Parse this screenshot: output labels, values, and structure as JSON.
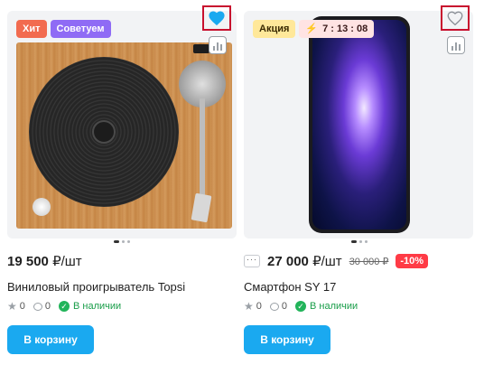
{
  "products": [
    {
      "badges": [
        "Хит",
        "Советуем"
      ],
      "favorite": true,
      "price": "19 500",
      "unit": "₽/шт",
      "name": "Виниловый проигрыватель Topsi",
      "rating": "0",
      "reviews": "0",
      "stock": "В наличии",
      "button": "В корзину",
      "image_icon": "turntable-image"
    },
    {
      "badge_promo": "Акция",
      "timer": "7 : 13 : 08",
      "favorite": false,
      "price": "27 000",
      "unit": "₽/шт",
      "old_price": "30 000 ₽",
      "discount": "-10%",
      "name": "Смартфон SY 17",
      "rating": "0",
      "reviews": "0",
      "stock": "В наличии",
      "button": "В корзину",
      "image_icon": "smartphone-image"
    }
  ],
  "colors": {
    "accent": "#1aa9f0",
    "favorite_active": "#1aa9f0",
    "highlight_border": "#c8102e",
    "stock": "#1a9e4a",
    "discount": "#ff3b46"
  }
}
